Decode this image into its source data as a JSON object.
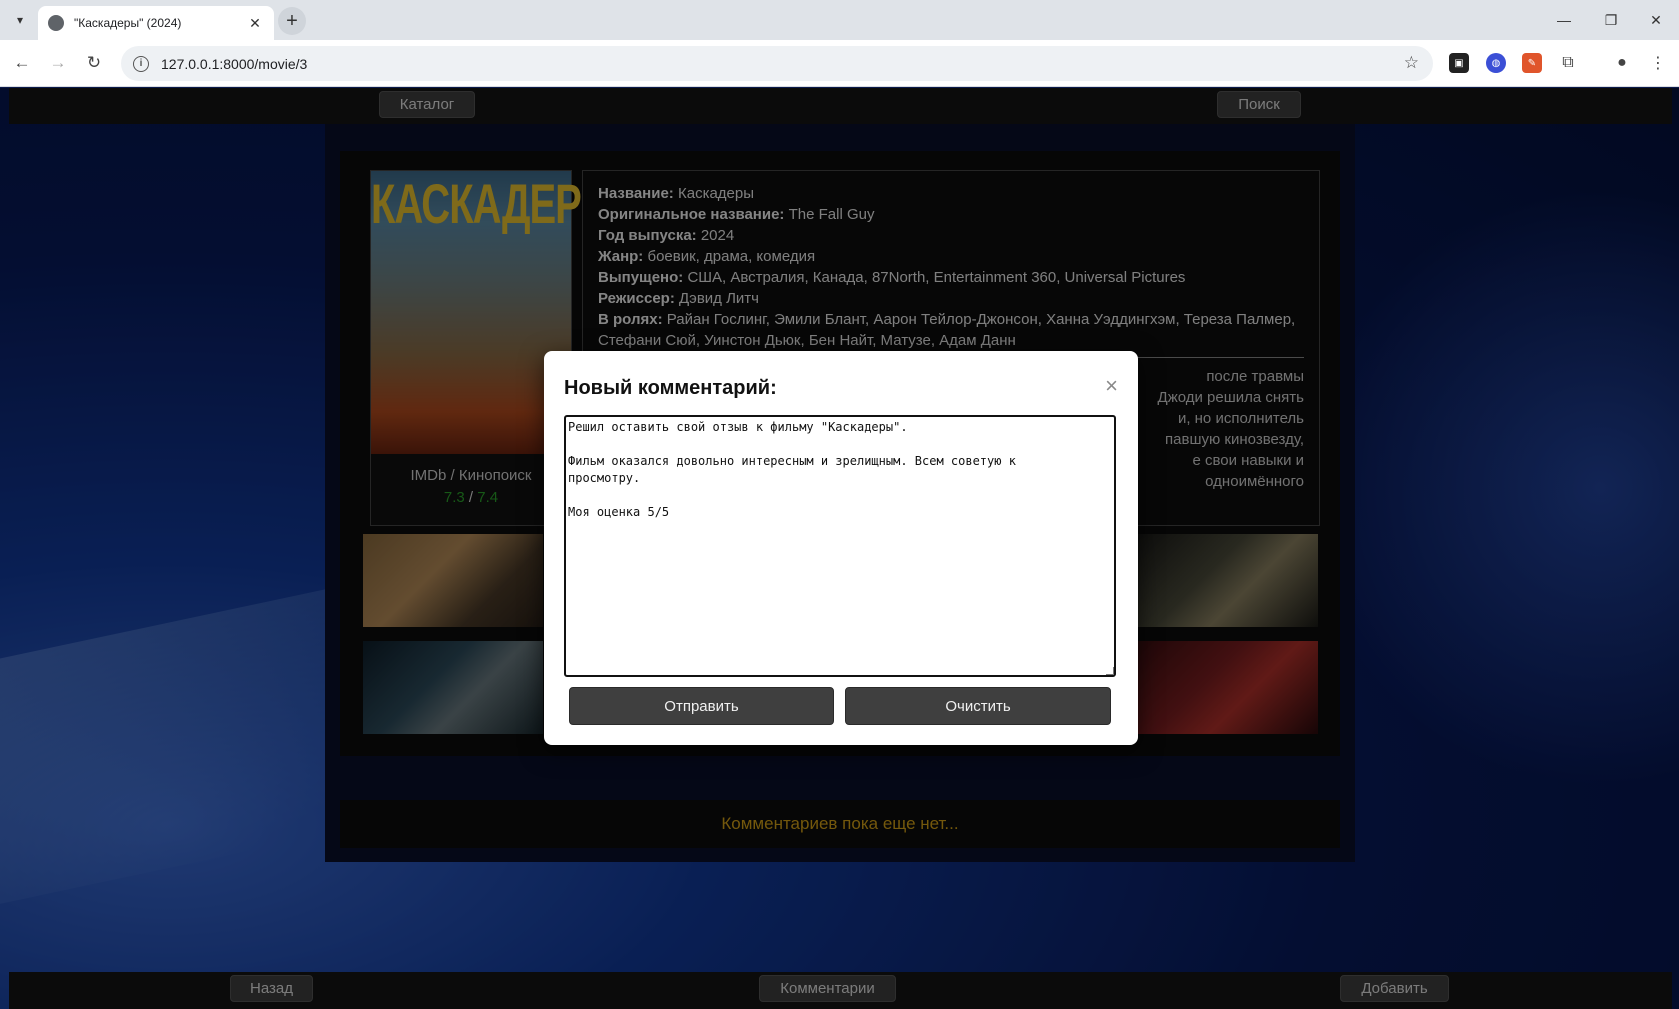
{
  "browser": {
    "tab_title": "\"Каскадеры\" (2024)",
    "url": "127.0.0.1:8000/movie/3",
    "new_tab_symbol": "+",
    "close_symbol": "✕"
  },
  "site": {
    "nav": {
      "catalog": "Каталог",
      "search": "Поиск"
    },
    "bottom_nav": {
      "back": "Назад",
      "comments": "Комментарии",
      "add": "Добавить"
    }
  },
  "movie": {
    "poster_title": "КАСКАДЕРЫ",
    "ratings_label": "IMDb / Кинопоиск",
    "imdb": "7.3",
    "separator": " / ",
    "kinopoisk": "7.4",
    "fields": [
      {
        "label": "Название:",
        "value": "Каскадеры"
      },
      {
        "label": "Оригинальное название:",
        "value": "The Fall Guy"
      },
      {
        "label": "Год выпуска:",
        "value": "2024"
      },
      {
        "label": "Жанр:",
        "value": "боевик, драма, комедия"
      },
      {
        "label": "Выпущено:",
        "value": "США, Австралия, Канада, 87North, Entertainment 360, Universal Pictures"
      },
      {
        "label": "Режиссер:",
        "value": "Дэвид Литч"
      },
      {
        "label": "В ролях:",
        "value": "Райан Гослинг, Эмили Блант, Аарон Тейлор-Джонсон, Ханна Уэддингхэм, Тереза Палмер, Стефани Сюй, Уинстон Дьюк, Бен Найт, Матузе, Адам Данн"
      }
    ],
    "synopsis_lines": [
      "после травмы",
      "Джоди решила снять",
      "и, но исполнитель",
      "павшую кинозвезду,",
      "е свои навыки и",
      "одноимённого"
    ]
  },
  "comments": {
    "empty_text": "Комментариев пока еще нет..."
  },
  "modal": {
    "title": "Новый комментарий:",
    "close_symbol": "×",
    "text": "Решил оставить свой отзыв к фильму \"Каскадеры\".\n\nФильм оказался довольно интересным и зрелищным. Всем советую к\nпросмотру.\n\nМоя оценка 5/5",
    "submit": "Отправить",
    "clear": "Очистить"
  }
}
